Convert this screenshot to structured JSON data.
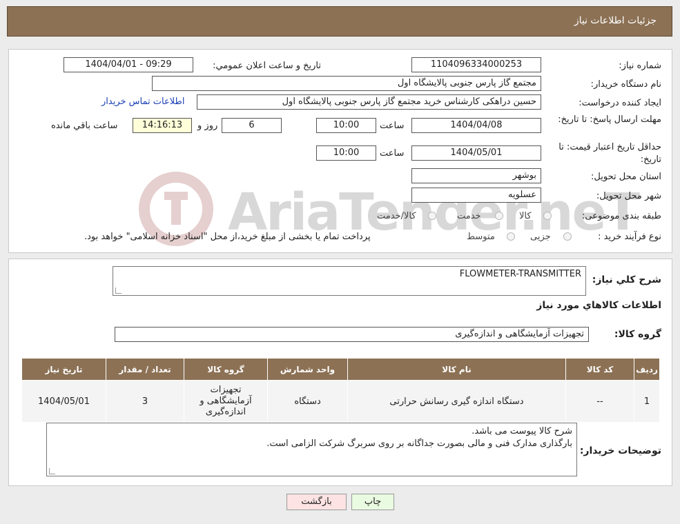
{
  "header": {
    "title": "جزئیات اطلاعات نیاز"
  },
  "watermark": {
    "text": "AriaTender.neT"
  },
  "form": {
    "need_number_label": "شماره نیاز:",
    "need_number": "1104096334000253",
    "announce_label": "تاریخ و ساعت اعلان عمومي:",
    "announce_value": "1404/04/01 - 09:29",
    "buyer_label": "نام دستگاه خريدار:",
    "buyer_value": "مجتمع گاز پارس جنوبی  پالایشگاه اول",
    "creator_label": "ايجاد کننده درخواست:",
    "creator_value": "حسین دراهکی کارشناس خرید مجتمع گاز پارس جنوبی  پالایشگاه اول",
    "contact_link": "اطلاعات تماس خريدار",
    "deadline_label": "مهلت ارسال پاسخ: تا تاريخ:",
    "deadline_date": "1404/04/08",
    "time_label": "ساعت",
    "deadline_time": "10:00",
    "days_value": "6",
    "days_label": "روز و",
    "remaining_time": "14:16:13",
    "remaining_label": "ساعت باقي مانده",
    "validity_label": "حداقل تاريخ اعتبار قيمت: تا تاريخ:",
    "validity_date": "1404/05/01",
    "validity_time": "10:00",
    "province_label": "استان محل تحويل:",
    "province_value": "بوشهر",
    "city_label": "شهر محل تحويل:",
    "city_value": "عسلویه",
    "category_label": "طبقه بندی موضوعی:",
    "category_options": [
      "كالا",
      "خدمت",
      "كالا/خدمت"
    ],
    "process_label": "نوع فرآيند خريد :",
    "process_options": [
      "جزیی",
      "متوسط"
    ],
    "process_note": "پرداخت تمام یا بخشی از مبلغ خرید،از محل \"اسناد خزانه اسلامی\" خواهد بود."
  },
  "details": {
    "summary_label": "شرح كلي نياز:",
    "summary_value": "FLOWMETER-TRANSMITTER",
    "items_heading": "اطلاعات كالاهاي مورد نياز",
    "group_label": "گروه كالا:",
    "group_value": "تجهیزات آزمایشگاهی و اندازه‌گیری",
    "table": {
      "headers": [
        "رديف",
        "كد كالا",
        "نام كالا",
        "واحد شمارش",
        "گروه كالا",
        "تعداد / مقدار",
        "تاريخ نياز"
      ],
      "rows": [
        {
          "row": "1",
          "code": "--",
          "name": "دستگاه اندازه گیری رسانش حرارتی",
          "unit": "دستگاه",
          "group": "تجهیزات آزمایشگاهی و اندازه‌گیری",
          "qty": "3",
          "date": "1404/05/01"
        }
      ]
    },
    "buyer_notes_label": "توضیحات خریدار:",
    "buyer_notes_line1": "شرح کالا پیوست می باشد.",
    "buyer_notes_line2": "بارگذاری مدارک فنی و مالی بصورت جداگانه بر روی سربرگ شرکت الزامی است."
  },
  "buttons": {
    "print": "چاپ",
    "back": "بازگشت"
  },
  "colors": {
    "header_bg": "#8c7155",
    "link": "#1a3fb5",
    "timer_bg": "#ffffd9"
  }
}
